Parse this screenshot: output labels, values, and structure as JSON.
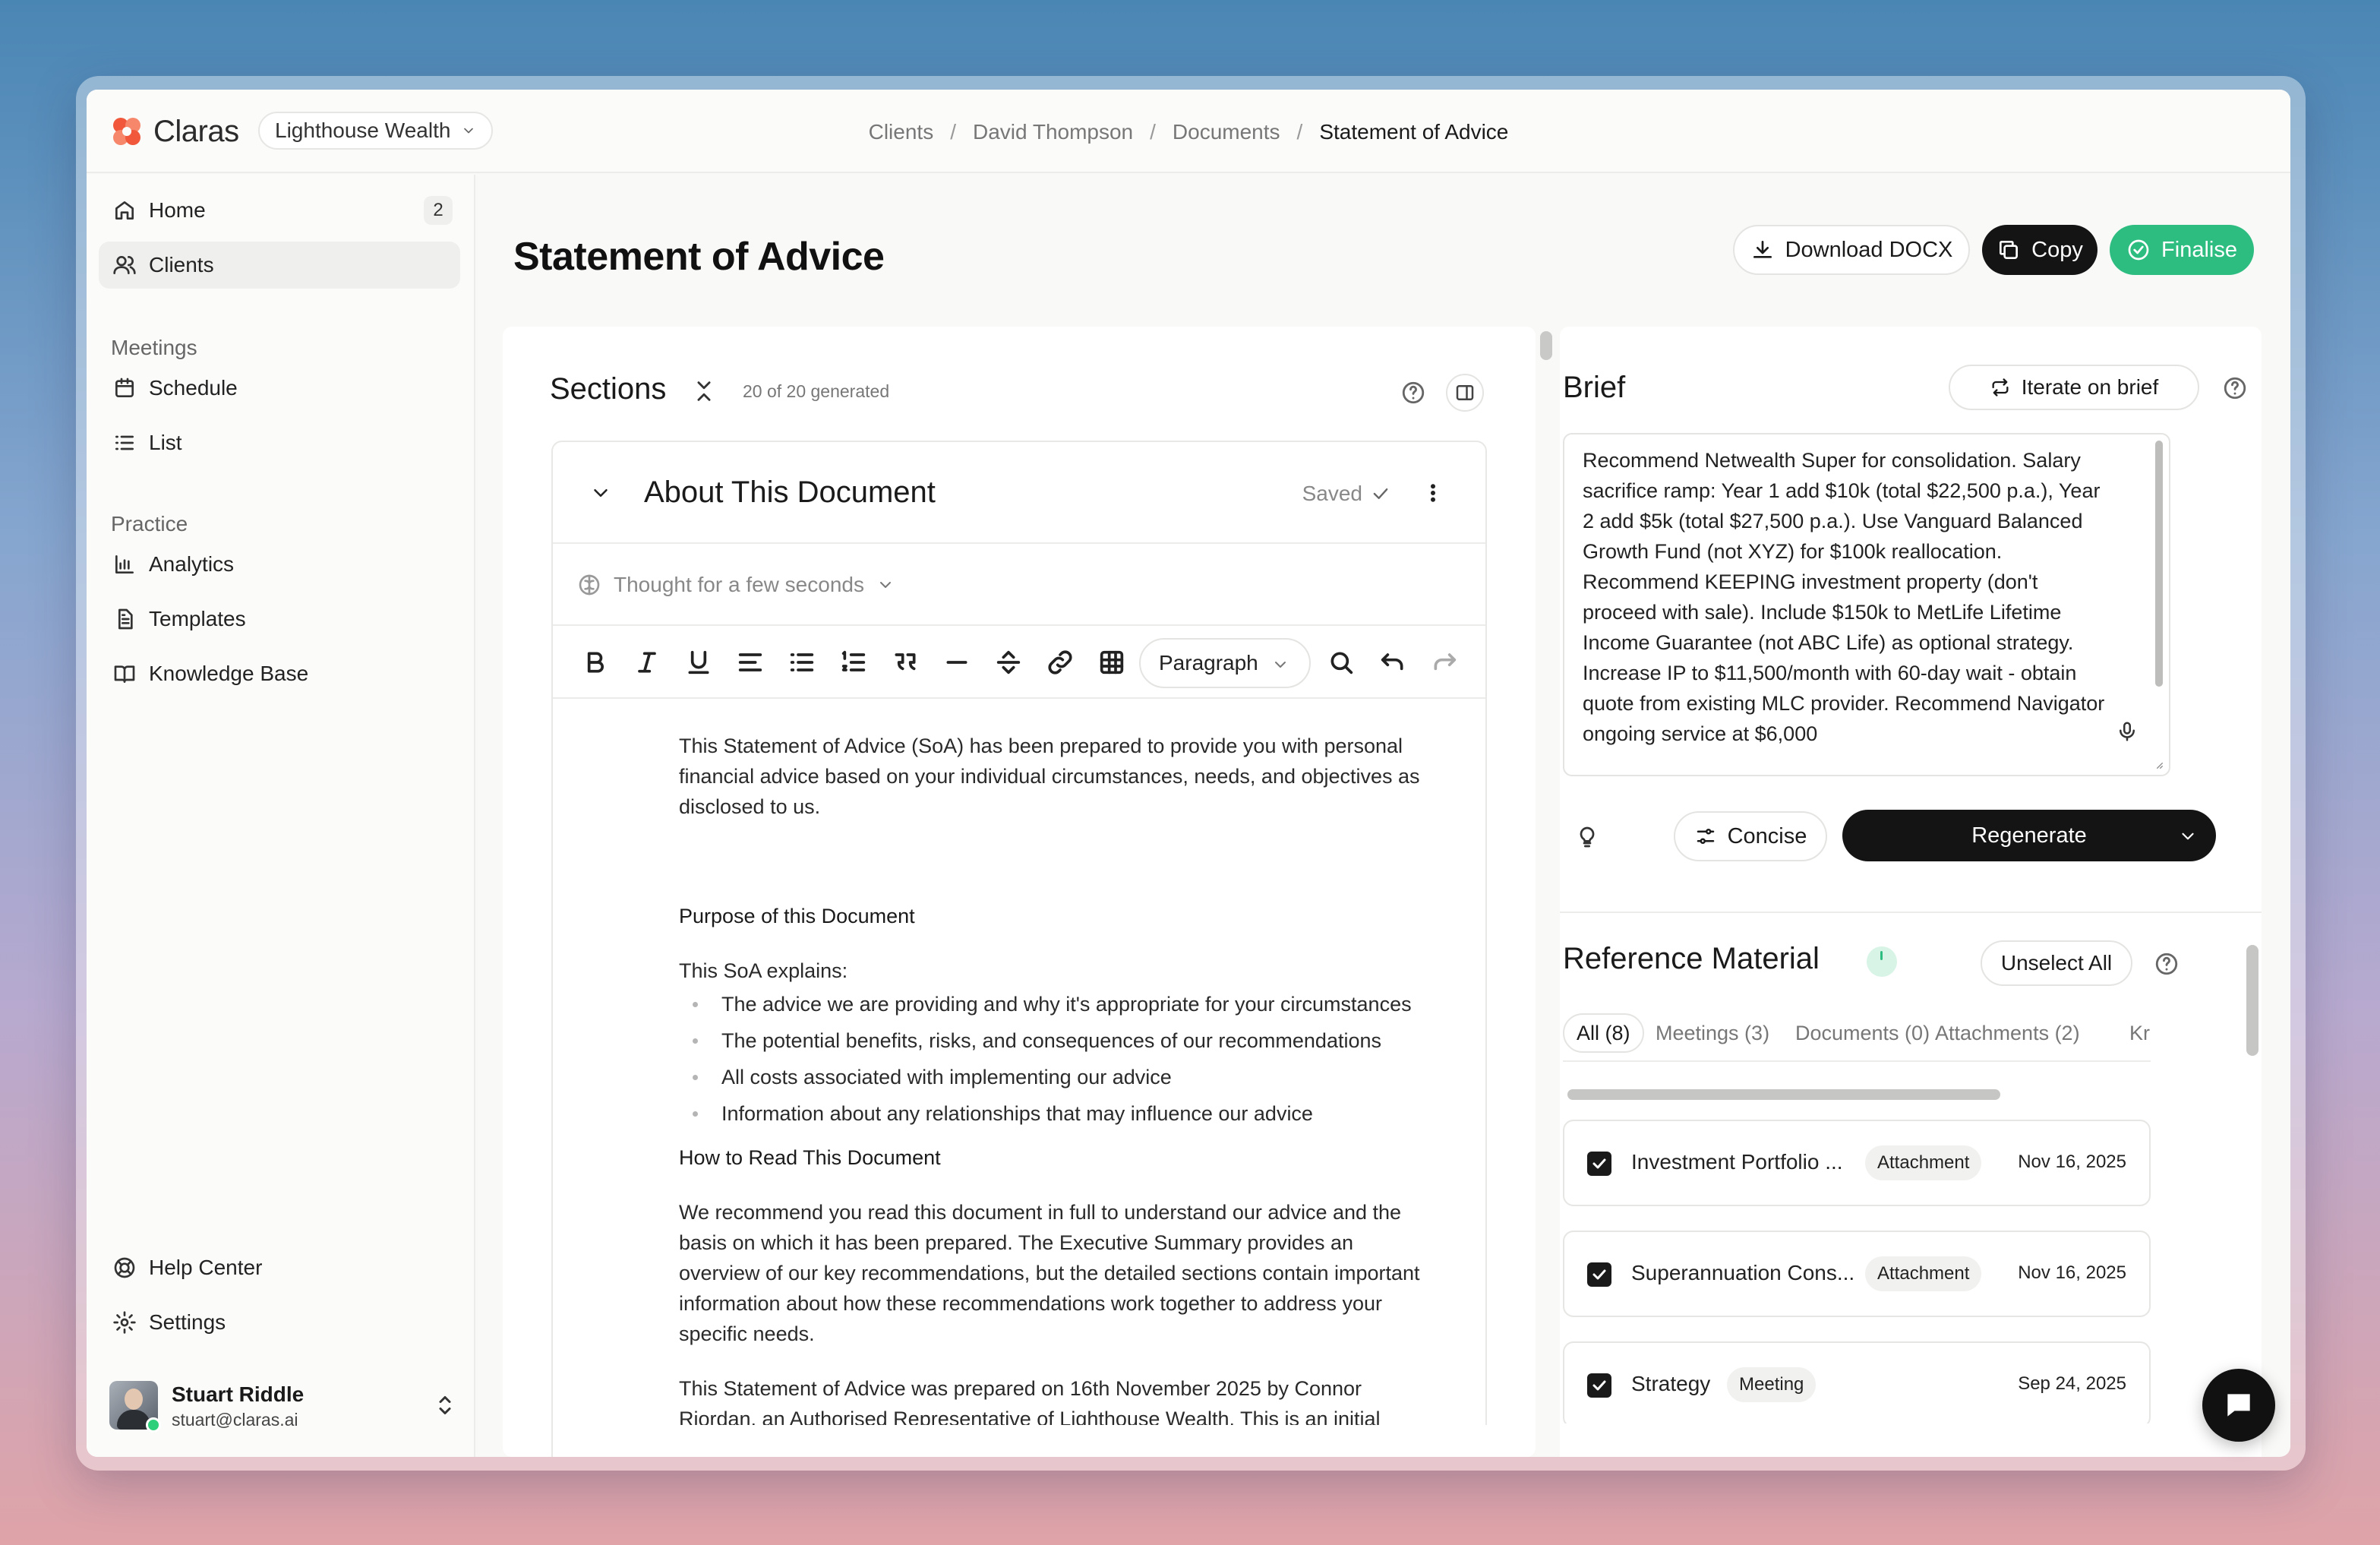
{
  "app": {
    "name": "Claras",
    "organization": "Lighthouse Wealth",
    "brand_color": "#f0573b",
    "accent_green": "#2ebd80"
  },
  "breadcrumb": [
    "Clients",
    "David Thompson",
    "Documents",
    "Statement of Advice"
  ],
  "sidebar": {
    "home": "Home",
    "home_badge": "2",
    "clients": "Clients",
    "meetings_label": "Meetings",
    "schedule": "Schedule",
    "list": "List",
    "practice_label": "Practice",
    "analytics": "Analytics",
    "templates": "Templates",
    "knowledge_base": "Knowledge Base",
    "help_center": "Help Center",
    "settings": "Settings",
    "user_name": "Stuart Riddle",
    "user_email": "stuart@claras.ai"
  },
  "page": {
    "title": "Statement of Advice",
    "download": "Download DOCX",
    "copy": "Copy",
    "finalise": "Finalise"
  },
  "sections": {
    "title": "Sections",
    "count": "20 of 20 generated",
    "doc_title": "About This Document",
    "saved": "Saved",
    "thought": "Thought for a few seconds",
    "paragraph_select": "Paragraph"
  },
  "document": {
    "intro": "This Statement of Advice (SoA) has been prepared to provide you with personal financial advice based on your individual circumstances, needs, and objectives as disclosed to us.",
    "purpose_heading": "Purpose of this Document",
    "soa_explains": "This SoA explains:",
    "bullets": [
      "The advice we are providing and why it's appropriate for your circumstances",
      "The potential benefits, risks, and consequences of our recommendations",
      "All costs associated with implementing our advice",
      "Information about any relationships that may influence our advice"
    ],
    "how_heading": "How to Read This Document",
    "how_body": "We recommend you read this document in full to understand our advice and the basis on which it has been prepared. The Executive Summary provides an overview of our key recommendations, but the detailed sections contain important information about how these recommendations work together to address your specific needs.",
    "prepared_line": "This Statement of Advice was prepared on 16th November 2025 by Connor",
    "cut_line": "Riordan, an Authorised Representative of Lighthouse Wealth. This is an initial"
  },
  "brief": {
    "title": "Brief",
    "iterate": "Iterate on brief",
    "text": "Recommend Netwealth Super for consolidation. Salary sacrifice ramp: Year 1 add $10k (total $22,500 p.a.), Year 2 add $5k (total $27,500 p.a.). Use Vanguard Balanced Growth Fund (not XYZ) for $100k reallocation. Recommend KEEPING investment property (don't proceed with sale). Include $150k to MetLife Lifetime Income Guarantee (not ABC Life) as optional strategy. Increase IP to $11,500/month with 60-day wait - obtain quote from existing MLC provider. Recommend Navigator ongoing service at $6,000",
    "concise": "Concise",
    "regenerate": "Regenerate"
  },
  "reference": {
    "title": "Reference Material",
    "unselect_all": "Unselect All",
    "tabs": [
      "All (8)",
      "Meetings (3)",
      "Documents (0)",
      "Attachments (2)",
      "Kr"
    ],
    "items": [
      {
        "name": "Investment Portfolio ...",
        "tag": "Attachment",
        "date": "Nov 16, 2025"
      },
      {
        "name": "Superannuation Cons...",
        "tag": "Attachment",
        "date": "Nov 16, 2025"
      },
      {
        "name": "Strategy",
        "tag": "Meeting",
        "date": "Sep 24, 2025"
      }
    ]
  }
}
